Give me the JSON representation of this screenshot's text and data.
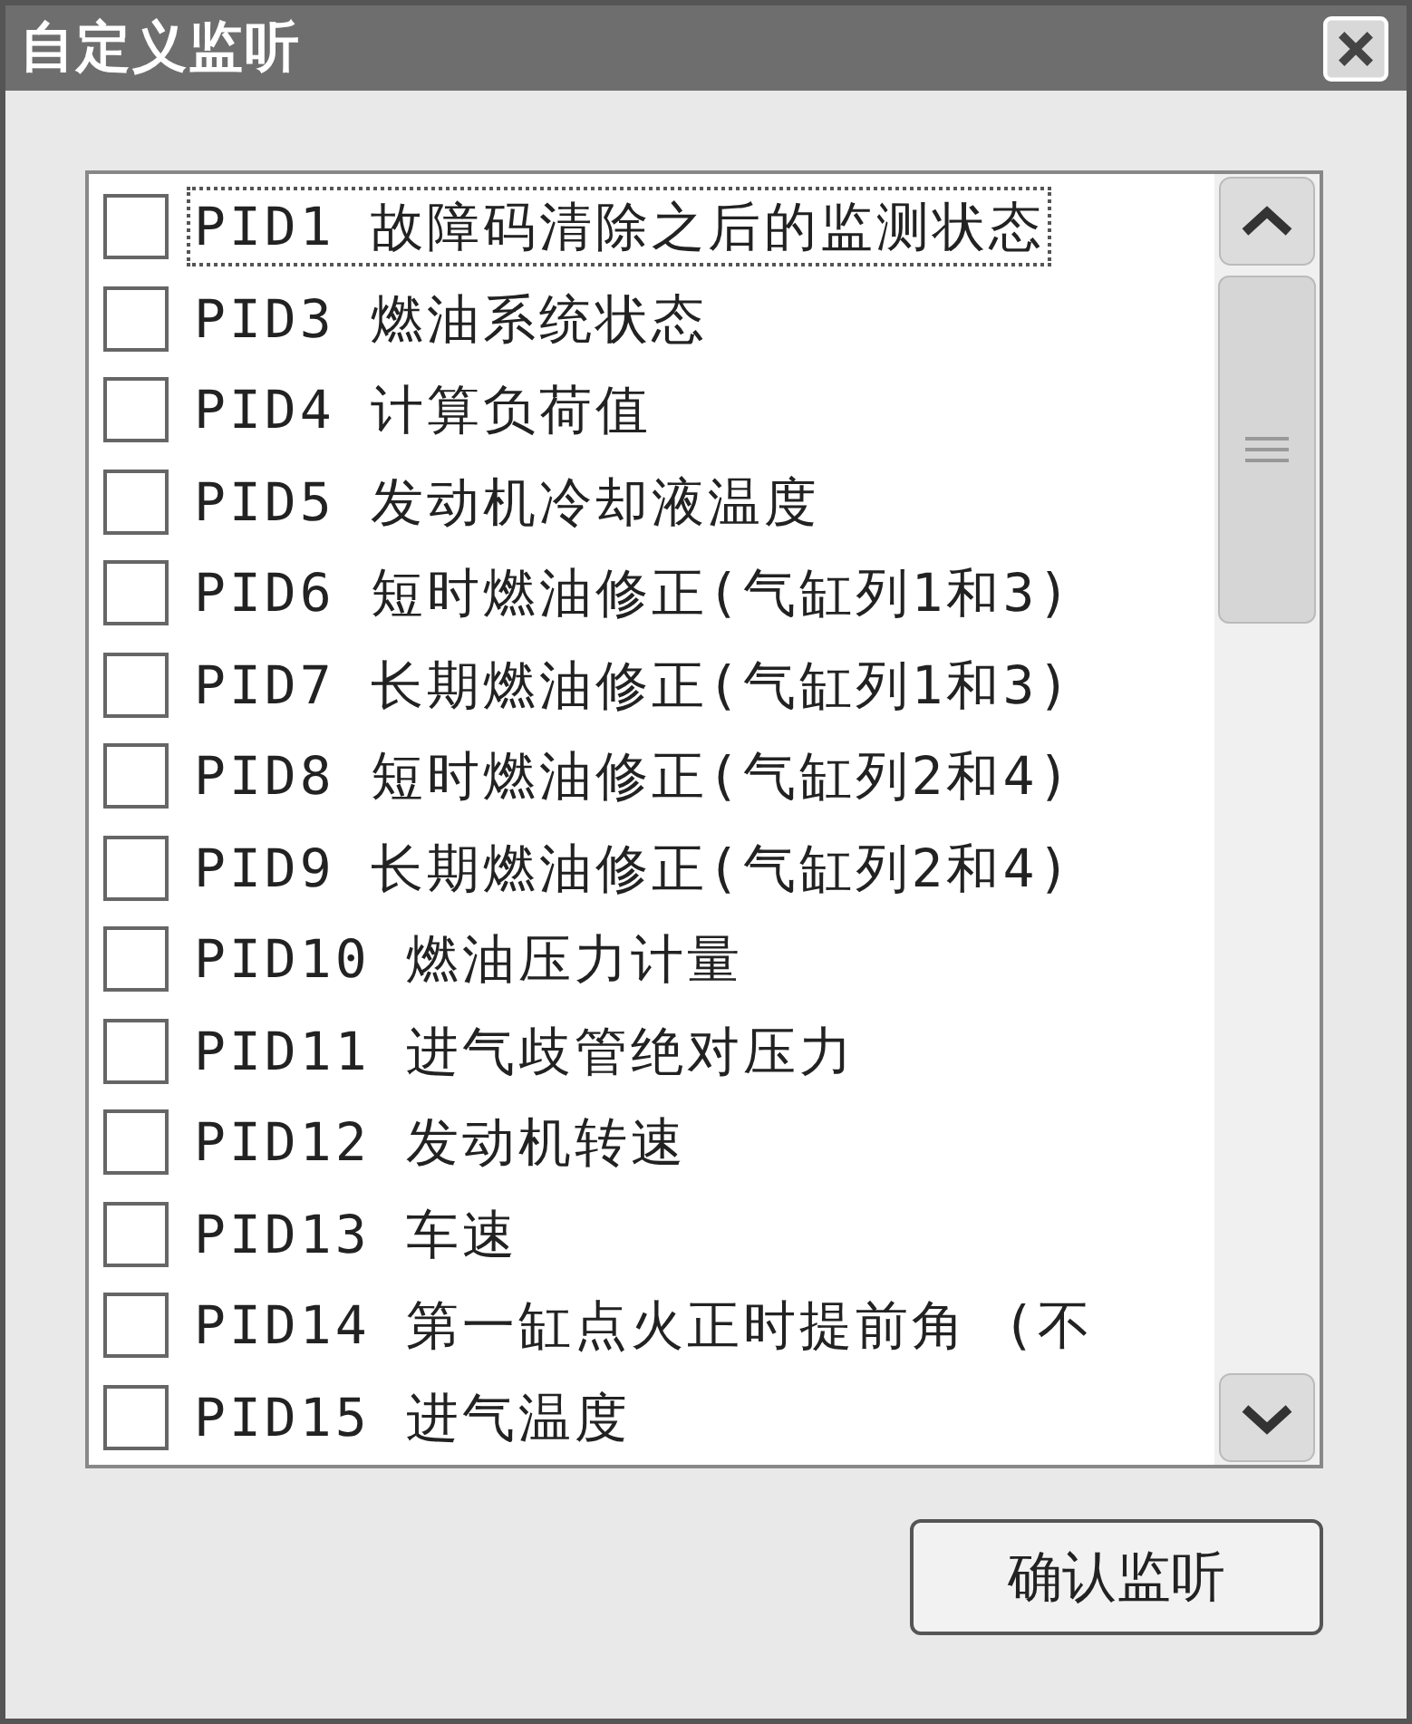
{
  "window": {
    "title": "自定义监听"
  },
  "list": {
    "items": [
      {
        "label": "PID1 故障码清除之后的监测状态",
        "checked": false,
        "focused": true
      },
      {
        "label": "PID3 燃油系统状态",
        "checked": false,
        "focused": false
      },
      {
        "label": "PID4 计算负荷值",
        "checked": false,
        "focused": false
      },
      {
        "label": "PID5 发动机冷却液温度",
        "checked": false,
        "focused": false
      },
      {
        "label": "PID6 短时燃油修正(气缸列1和3)",
        "checked": false,
        "focused": false
      },
      {
        "label": "PID7 长期燃油修正(气缸列1和3)",
        "checked": false,
        "focused": false
      },
      {
        "label": "PID8 短时燃油修正(气缸列2和4)",
        "checked": false,
        "focused": false
      },
      {
        "label": "PID9 长期燃油修正(气缸列2和4)",
        "checked": false,
        "focused": false
      },
      {
        "label": "PID10 燃油压力计量",
        "checked": false,
        "focused": false
      },
      {
        "label": "PID11 进气歧管绝对压力",
        "checked": false,
        "focused": false
      },
      {
        "label": "PID12 发动机转速",
        "checked": false,
        "focused": false
      },
      {
        "label": "PID13 车速",
        "checked": false,
        "focused": false
      },
      {
        "label": "PID14 第一缸点火正时提前角 (不",
        "checked": false,
        "focused": false
      },
      {
        "label": "PID15 进气温度",
        "checked": false,
        "focused": false
      }
    ]
  },
  "buttons": [
    {
      "label": "确认监听"
    }
  ]
}
